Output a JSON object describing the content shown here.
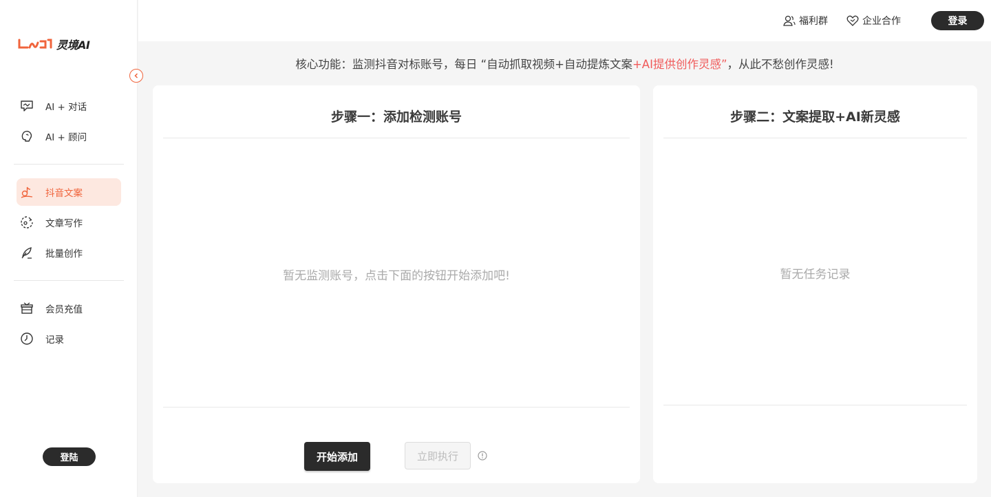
{
  "brand": {
    "name": "灵境AI",
    "accent": "#f0643c"
  },
  "sidebar": {
    "groups": [
      {
        "items": [
          {
            "label": "AI + 对话",
            "icon": "chat-icon"
          },
          {
            "label": "AI + 顾问",
            "icon": "advisor-icon"
          }
        ]
      },
      {
        "items": [
          {
            "label": "抖音文案",
            "icon": "douyin-icon",
            "active": true
          },
          {
            "label": "文章写作",
            "icon": "article-icon"
          },
          {
            "label": "批量创作",
            "icon": "quill-icon"
          }
        ]
      },
      {
        "items": [
          {
            "label": "会员充值",
            "icon": "gift-box-icon"
          },
          {
            "label": "记录",
            "icon": "clock-icon"
          }
        ]
      }
    ],
    "login_label": "登陆"
  },
  "topbar": {
    "welfare_label": "福利群",
    "enterprise_label": "企业合作",
    "login_label": "登录"
  },
  "notice": {
    "prefix": "核心功能：监测抖音对标账号，每日 “自动抓取视频+自动提炼文案",
    "highlight": "+AI提供创作灵感”",
    "suffix": "，从此不愁创作灵感!",
    "highlight_color": "#f05a5a"
  },
  "step1": {
    "title": "步骤一：添加检测账号",
    "empty_text": "暂无监测账号，点击下面的按钮开始添加吧!",
    "add_button": "开始添加",
    "run_button": "立即执行"
  },
  "step2": {
    "title": "步骤二：文案提取+AI新灵感",
    "empty_text": "暂无任务记录"
  }
}
